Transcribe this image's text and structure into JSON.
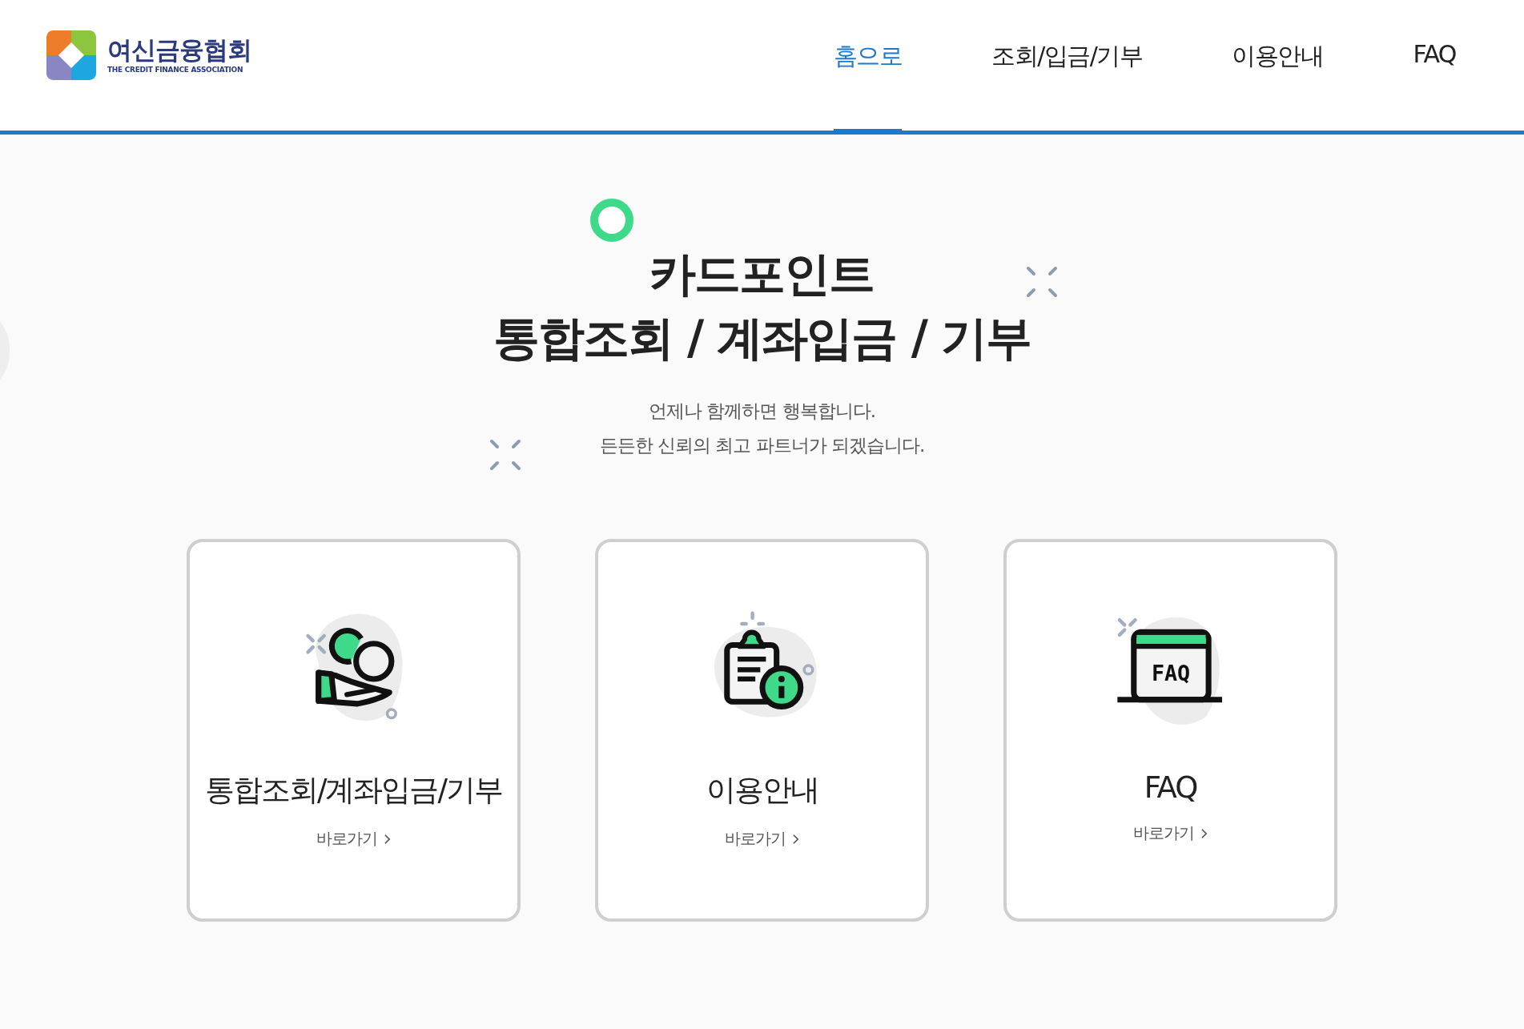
{
  "header": {
    "logo": {
      "name": "여신금융협회",
      "subtitle": "THE CREDIT FINANCE ASSOCIATION"
    },
    "nav": [
      {
        "label": "홈으로",
        "selected": true
      },
      {
        "label": "조회/입금/기부",
        "selected": false
      },
      {
        "label": "이용안내",
        "selected": false
      },
      {
        "label": "FAQ",
        "selected": false
      }
    ]
  },
  "hero": {
    "title_lines": [
      "카드포인트",
      "통합조회 / 계좌입금 / 기부"
    ],
    "subtitle_lines": [
      "언제나 함께하면 행복합니다.",
      "든든한 신뢰의 최고 파트너가 되겠습니다."
    ]
  },
  "cards": [
    {
      "kind": "coins",
      "title": "통합조회/계좌입금/기부",
      "link": "바로가기"
    },
    {
      "kind": "clipboard",
      "title": "이용안내",
      "link": "바로가기"
    },
    {
      "kind": "faq",
      "title": "FAQ",
      "link": "바로가기",
      "icon_text": "FAQ"
    }
  ]
}
